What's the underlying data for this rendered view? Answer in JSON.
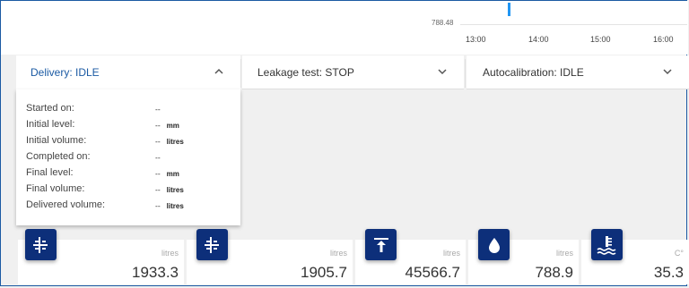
{
  "chart": {
    "y_value_label": "788.48",
    "x_ticks": [
      "13:00",
      "14:00",
      "15:00",
      "16:00"
    ]
  },
  "panels": {
    "delivery": {
      "title": "Delivery: IDLE"
    },
    "leakage": {
      "title": "Leakage test: STOP"
    },
    "autocalibration": {
      "title": "Autocalibration: IDLE"
    }
  },
  "delivery_details": {
    "rows": [
      {
        "label": "Started on:",
        "value": "--",
        "unit": ""
      },
      {
        "label": "Initial level:",
        "value": "--",
        "unit": "mm"
      },
      {
        "label": "Initial volume:",
        "value": "--",
        "unit": "litres"
      },
      {
        "label": "Completed on:",
        "value": "--",
        "unit": ""
      },
      {
        "label": "Final level:",
        "value": "--",
        "unit": "mm"
      },
      {
        "label": "Final volume:",
        "value": "--",
        "unit": "litres"
      },
      {
        "label": "Delivered volume:",
        "value": "--",
        "unit": "litres"
      }
    ]
  },
  "tiles": [
    {
      "unit": "litres",
      "value": "1933.3",
      "icon": "volume-icon"
    },
    {
      "unit": "litres",
      "value": "1905.7",
      "icon": "volume-icon"
    },
    {
      "unit": "litres",
      "value": "45566.7",
      "icon": "ullage-icon"
    },
    {
      "unit": "litres",
      "value": "788.9",
      "icon": "water-drop-icon"
    },
    {
      "unit": "C°",
      "value": "35.3",
      "icon": "temperature-icon"
    }
  ],
  "colors": {
    "accent": "#0d2f7a",
    "title_blue": "#1b5aa3",
    "marker": "#2196f3"
  }
}
